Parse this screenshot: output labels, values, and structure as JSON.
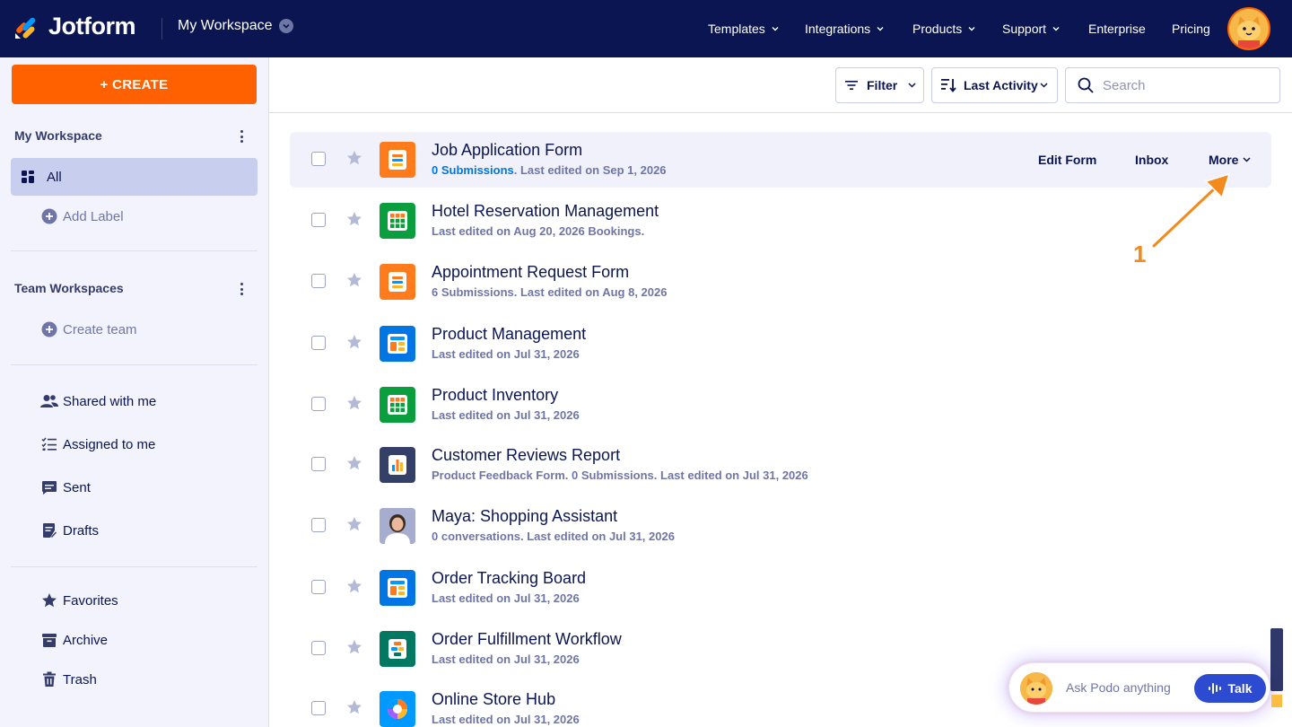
{
  "header": {
    "logo_text": "Jotform",
    "workspace_label": "My Workspace",
    "nav": [
      {
        "label": "Templates",
        "has_caret": true
      },
      {
        "label": "Integrations",
        "has_caret": true
      },
      {
        "label": "Products",
        "has_caret": true
      },
      {
        "label": "Support",
        "has_caret": true
      },
      {
        "label": "Enterprise",
        "has_caret": false
      },
      {
        "label": "Pricing",
        "has_caret": false
      }
    ]
  },
  "sidebar": {
    "create_label": "+ CREATE",
    "my_workspace_heading": "My Workspace",
    "all_label": "All",
    "add_label": "Add Label",
    "team_heading": "Team Workspaces",
    "create_team_label": "Create team",
    "shared_label": "Shared with me",
    "assigned_label": "Assigned to me",
    "sent_label": "Sent",
    "drafts_label": "Drafts",
    "favorites_label": "Favorites",
    "archive_label": "Archive",
    "trash_label": "Trash"
  },
  "toolbar": {
    "filter_label": "Filter",
    "sort_label": "Last Activity",
    "search_placeholder": "Search"
  },
  "row_actions": {
    "edit_label": "Edit Form",
    "inbox_label": "Inbox",
    "more_label": "More"
  },
  "items": [
    {
      "title": "Job Application Form",
      "submissions": "0 Submissions",
      "meta": ". Last edited on Sep 1, 2026",
      "icon": "form-icon"
    },
    {
      "title": "Hotel Reservation Management",
      "submissions": "",
      "meta": "Last edited on Aug 20, 2026 Bookings.",
      "icon": "table-icon"
    },
    {
      "title": "Appointment Request Form",
      "submissions": "",
      "meta": "6 Submissions. Last edited on Aug 8, 2026",
      "icon": "form-icon"
    },
    {
      "title": "Product Management",
      "submissions": "",
      "meta": "Last edited on Jul 31, 2026",
      "icon": "app-icon"
    },
    {
      "title": "Product Inventory",
      "submissions": "",
      "meta": "Last edited on Jul 31, 2026",
      "icon": "table-icon"
    },
    {
      "title": "Customer Reviews Report",
      "submissions": "",
      "meta": "Product Feedback Form. 0 Submissions. Last edited on Jul 31, 2026",
      "icon": "report-icon"
    },
    {
      "title": "Maya: Shopping Assistant",
      "submissions": "",
      "meta": "0 conversations. Last edited on Jul 31, 2026",
      "icon": "agent-avatar-icon"
    },
    {
      "title": "Order Tracking Board",
      "submissions": "",
      "meta": "Last edited on Jul 31, 2026",
      "icon": "app-icon"
    },
    {
      "title": "Order Fulfillment Workflow",
      "submissions": "",
      "meta": " Last edited on Jul 31, 2026",
      "icon": "workflow-icon"
    },
    {
      "title": "Online Store Hub",
      "submissions": "",
      "meta": "Last edited on Jul 31, 2026",
      "icon": "store-icon"
    }
  ],
  "annotation": {
    "number": "1"
  },
  "podo": {
    "placeholder": "Ask Podo anything",
    "talk_label": "Talk"
  },
  "colors": {
    "navy": "#0a1551",
    "orange": "#ff6100",
    "sidebar_bg": "#f3f3fe",
    "active_item": "#c8ceed",
    "link_blue": "#0075e3",
    "form_orange": "#ff7b1c",
    "table_green": "#0b9e3f",
    "app_blue": "#0075e3",
    "report_navy": "#344067",
    "workflow_green": "#007862",
    "talk_blue": "#2d4bd1"
  }
}
